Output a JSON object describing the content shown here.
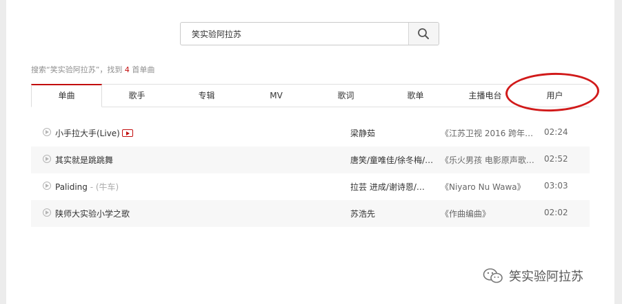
{
  "search": {
    "query": "笑实验阿拉苏"
  },
  "summary": {
    "prefix": "搜索“笑实验阿拉苏”，找到 ",
    "count": "4",
    "suffix": " 首单曲"
  },
  "tabs": [
    {
      "label": "单曲"
    },
    {
      "label": "歌手"
    },
    {
      "label": "专辑"
    },
    {
      "label": "MV"
    },
    {
      "label": "歌词"
    },
    {
      "label": "歌单"
    },
    {
      "label": "主播电台"
    },
    {
      "label": "用户"
    }
  ],
  "songs": [
    {
      "title": "小手拉大手(Live)",
      "alias": "",
      "artist": "梁静茹",
      "album": "《江苏卫视 2016 跨年…",
      "duration": "02:24"
    },
    {
      "title": "其实就是跳跳舞",
      "alias": "",
      "artist": "唐笑/童唯佳/徐冬梅/…",
      "album": "《乐火男孩 电影原声歌…",
      "duration": "02:52"
    },
    {
      "title": "Paliding",
      "alias": " - (牛车)",
      "artist": "拉芸 进成/谢诗恩/…",
      "album": "《Niyaro Nu Wawa》",
      "duration": "03:03"
    },
    {
      "title": "陕师大实验小学之歌",
      "alias": "",
      "artist": "苏浩先",
      "album": "《作曲编曲》",
      "duration": "02:02"
    }
  ],
  "watermark": {
    "text": "笑实验阿拉苏"
  },
  "colors": {
    "accent": "#c20c0c",
    "annotation": "#d11a1a"
  }
}
